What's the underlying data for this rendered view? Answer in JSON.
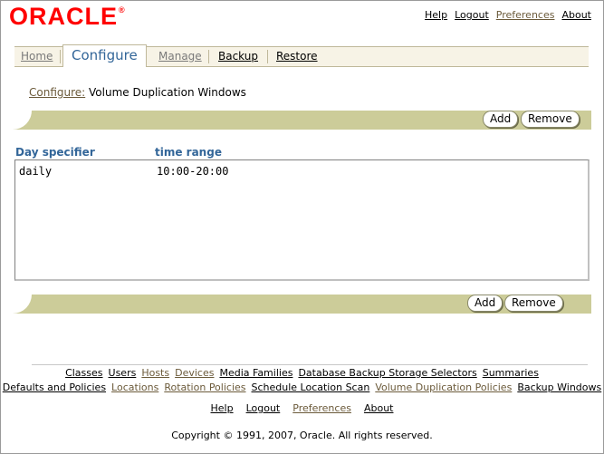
{
  "header": {
    "logo": "ORACLE",
    "logo_mark": "®",
    "links": [
      {
        "label": "Help",
        "muted": false
      },
      {
        "label": "Logout",
        "muted": false
      },
      {
        "label": "Preferences",
        "muted": true
      },
      {
        "label": "About",
        "muted": false
      }
    ]
  },
  "tabs": [
    {
      "label": "Home",
      "state": "dim"
    },
    {
      "label": "Configure",
      "state": "active"
    },
    {
      "label": "Manage",
      "state": "dim"
    },
    {
      "label": "Backup",
      "state": "normal"
    },
    {
      "label": "Restore",
      "state": "normal"
    }
  ],
  "breadcrumb": {
    "link": "Configure:",
    "current": "Volume Duplication Windows"
  },
  "actions": {
    "add": "Add",
    "remove": "Remove"
  },
  "table": {
    "columns": [
      "Day specifier",
      "time range"
    ],
    "rows": [
      [
        "daily",
        "10:00-20:00"
      ]
    ]
  },
  "footer": {
    "row1": [
      {
        "label": "Classes",
        "muted": false
      },
      {
        "label": "Users",
        "muted": false
      },
      {
        "label": "Hosts",
        "muted": true
      },
      {
        "label": "Devices",
        "muted": true
      },
      {
        "label": "Media Families",
        "muted": false
      },
      {
        "label": "Database Backup Storage Selectors",
        "muted": false
      },
      {
        "label": "Summaries",
        "muted": false
      }
    ],
    "row2": [
      {
        "label": "Defaults and Policies",
        "muted": false
      },
      {
        "label": "Locations",
        "muted": true
      },
      {
        "label": "Rotation Policies",
        "muted": true
      },
      {
        "label": "Schedule Location Scan",
        "muted": false
      },
      {
        "label": "Volume Duplication Policies",
        "muted": true
      },
      {
        "label": "Backup Windows",
        "muted": false
      }
    ],
    "row3": [
      {
        "label": "Help",
        "muted": false
      },
      {
        "label": "Logout",
        "muted": false
      },
      {
        "label": "Preferences",
        "muted": true
      },
      {
        "label": "About",
        "muted": false
      }
    ],
    "copyright": "Copyright © 1991, 2007, Oracle. All rights reserved."
  },
  "colors": {
    "accent": "#336699",
    "bar": "#cccc99",
    "logo": "#ff0000",
    "link_muted": "#6b5a3a"
  }
}
